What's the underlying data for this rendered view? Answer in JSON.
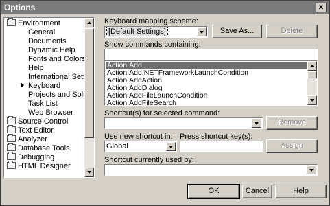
{
  "window": {
    "title": "Options",
    "close_glyph": "✕"
  },
  "tree": {
    "items": [
      {
        "label": "Environment",
        "type": "folder"
      },
      {
        "label": "General",
        "type": "child"
      },
      {
        "label": "Documents",
        "type": "child"
      },
      {
        "label": "Dynamic Help",
        "type": "child"
      },
      {
        "label": "Fonts and Colors",
        "type": "child"
      },
      {
        "label": "Help",
        "type": "child"
      },
      {
        "label": "International Settings",
        "type": "child"
      },
      {
        "label": "Keyboard",
        "type": "child-selected"
      },
      {
        "label": "Projects and Solutions",
        "type": "child"
      },
      {
        "label": "Task List",
        "type": "child"
      },
      {
        "label": "Web Browser",
        "type": "child"
      },
      {
        "label": "Source Control",
        "type": "folder"
      },
      {
        "label": "Text Editor",
        "type": "folder"
      },
      {
        "label": "Analyzer",
        "type": "folder"
      },
      {
        "label": "Database Tools",
        "type": "folder"
      },
      {
        "label": "Debugging",
        "type": "folder"
      },
      {
        "label": "HTML Designer",
        "type": "folder"
      }
    ]
  },
  "keyboard": {
    "mapping_label": "Keyboard mapping scheme:",
    "mapping_value": "[Default Settings]",
    "save_as_label": "Save As...",
    "delete_label": "Delete",
    "show_commands_label": "Show commands containing:",
    "show_commands_value": "",
    "commands": [
      "Action.Add",
      "Action.Add.NETFrameworkLaunchCondition",
      "Action.AddAction",
      "Action.AddDialog",
      "Action.AddFileLaunchCondition",
      "Action.AddFileSearch"
    ],
    "selected_command_index": 0,
    "shortcuts_label": "Shortcut(s) for selected command:",
    "shortcuts_value": "",
    "remove_label": "Remove",
    "use_new_label": "Use new shortcut in:",
    "use_new_value": "Global",
    "press_key_label": "Press shortcut key(s):",
    "press_key_value": "",
    "assign_label": "Assign",
    "used_by_label": "Shortcut currently used by:",
    "used_by_value": ""
  },
  "footer": {
    "ok_label": "OK",
    "cancel_label": "Cancel",
    "help_label": "Help"
  },
  "colors": {
    "title_bg": "#7a7a7a",
    "selected_bg": "#6e6e6e",
    "face": "#d4d0c8"
  }
}
